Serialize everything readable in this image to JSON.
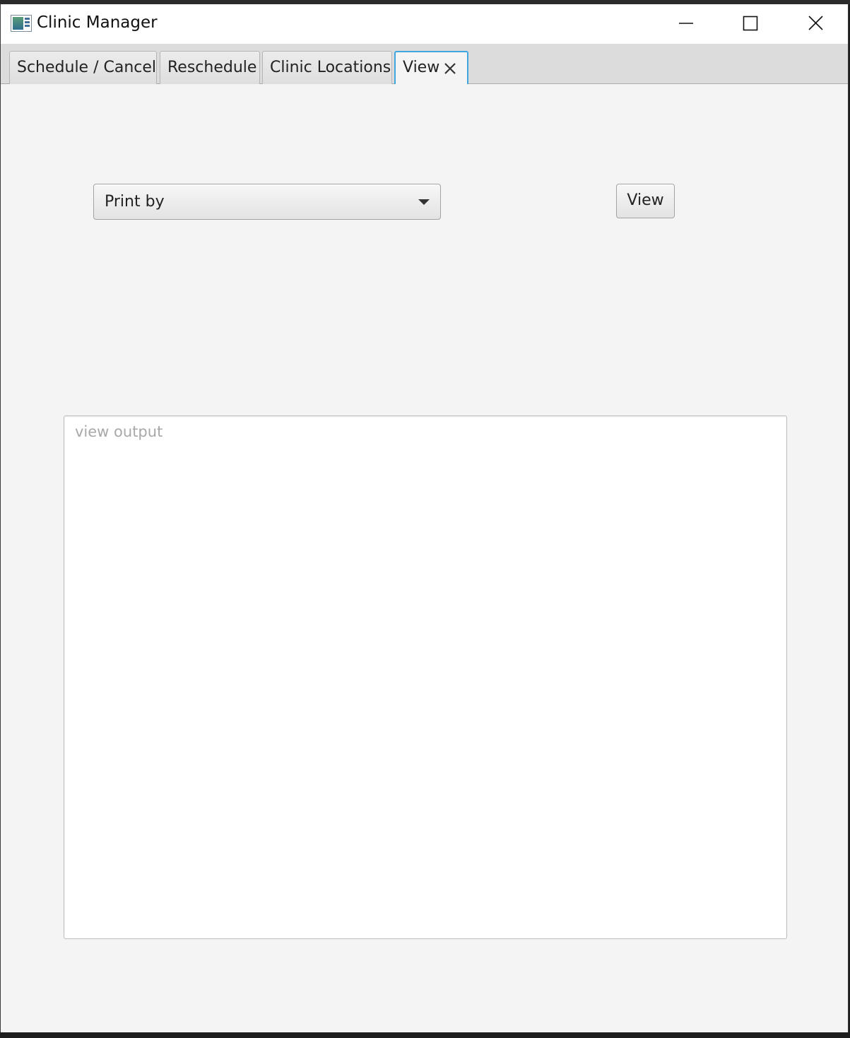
{
  "window": {
    "title": "Clinic Manager",
    "controls": [
      "minimize-icon",
      "maximize-icon",
      "close-icon"
    ]
  },
  "tabs": [
    {
      "label": "Schedule / Cancel",
      "active": false
    },
    {
      "label": "Reschedule",
      "active": false
    },
    {
      "label": "Clinic Locations",
      "active": false
    },
    {
      "label": "View",
      "active": true,
      "closable": true
    }
  ],
  "view_panel": {
    "print_by": {
      "selected": "Print by"
    },
    "view_button_label": "View",
    "output": {
      "placeholder": "view output",
      "value": ""
    }
  },
  "colors": {
    "accent": "#3fa6e0",
    "window_bg": "#f4f4f4",
    "tabbar_bg": "#dcdcdc"
  }
}
